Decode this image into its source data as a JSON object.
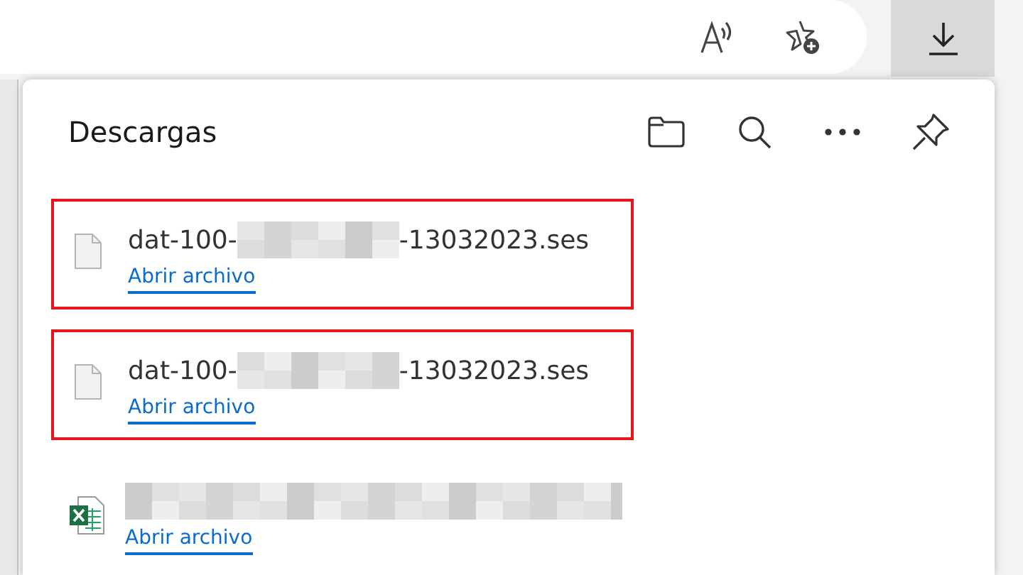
{
  "toolbar": {
    "download_button_active": true
  },
  "panel": {
    "title": "Descargas",
    "items": [
      {
        "kind": "file",
        "highlighted": true,
        "name_start": "dat-100-",
        "redacted": true,
        "name_end": "-13032023.ses",
        "link": "Abrir archivo"
      },
      {
        "kind": "file",
        "highlighted": true,
        "name_start": "dat-100-",
        "redacted": true,
        "name_end": "-13032023.ses",
        "link": "Abrir archivo"
      },
      {
        "kind": "excel",
        "highlighted": false,
        "redacted": true,
        "link": "Abrir archivo"
      }
    ]
  }
}
